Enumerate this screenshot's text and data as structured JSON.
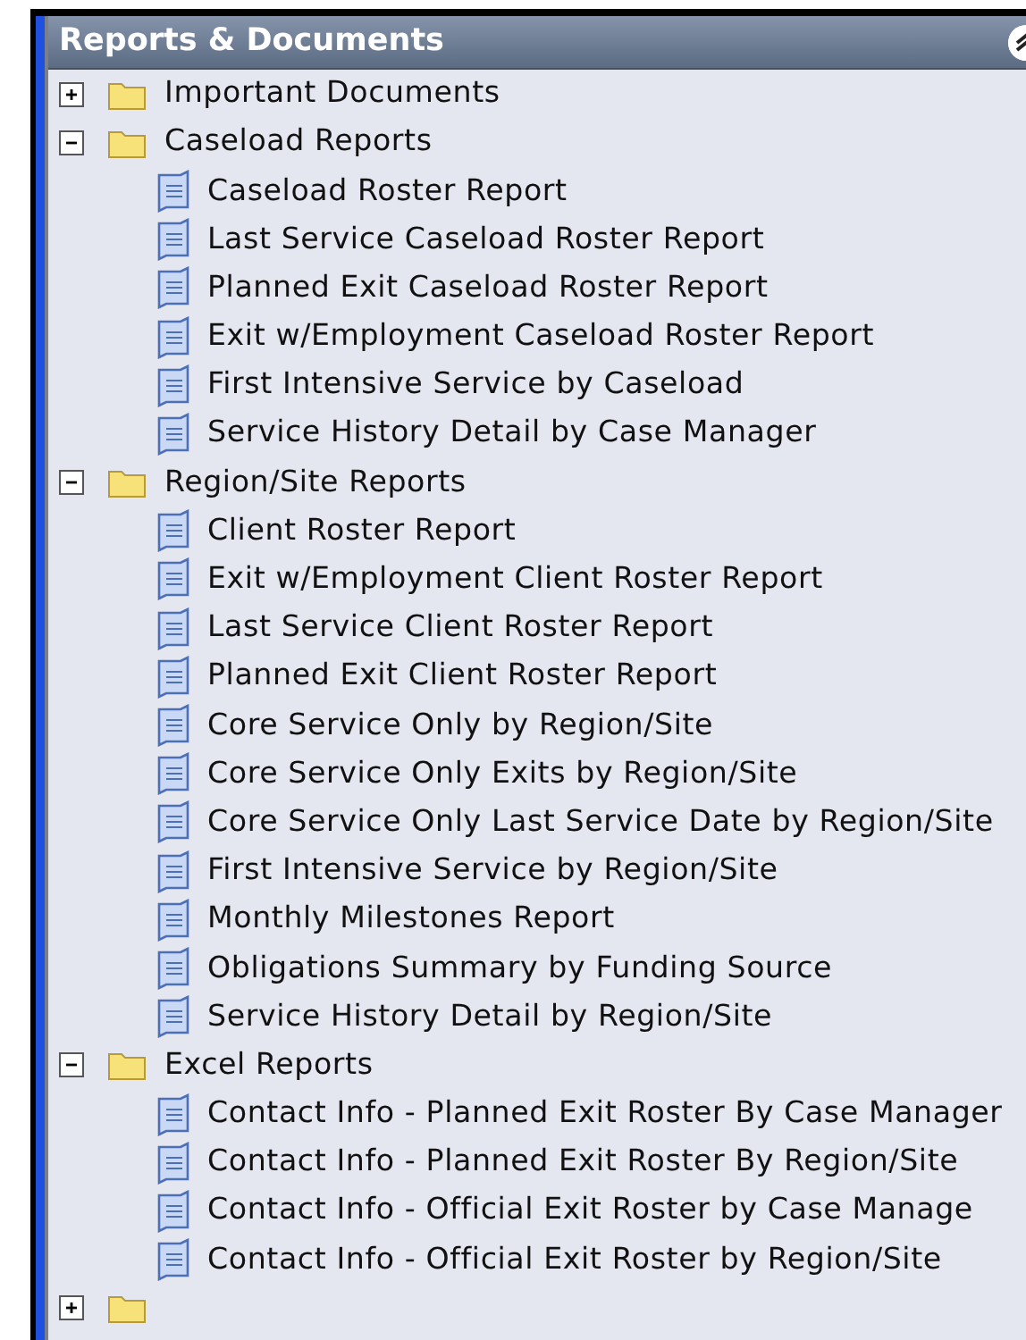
{
  "panel": {
    "title": "Reports & Documents"
  },
  "folders": [
    {
      "label": "Important Documents",
      "expanded": false
    },
    {
      "label": "Caseload Reports",
      "expanded": true,
      "children": [
        "Caseload Roster Report",
        "Last Service Caseload Roster Report",
        "Planned Exit Caseload Roster Report",
        "Exit w/Employment Caseload Roster Report",
        "First Intensive Service by Caseload",
        "Service History Detail by Case Manager"
      ]
    },
    {
      "label": "Region/Site Reports",
      "expanded": true,
      "children": [
        "Client Roster Report",
        "Exit w/Employment Client Roster Report",
        "Last Service Client Roster Report",
        "Planned Exit Client Roster Report",
        "Core Service Only by Region/Site",
        "Core Service Only Exits by Region/Site",
        "Core Service Only Last Service Date by Region/Site",
        "First Intensive Service by Region/Site",
        "Monthly Milestones Report",
        "Obligations Summary by Funding Source",
        "Service History Detail by Region/Site"
      ]
    },
    {
      "label": "Excel Reports",
      "expanded": true,
      "children": [
        "Contact Info - Planned Exit Roster By Case Manager",
        "Contact Info - Planned Exit Roster By Region/Site",
        "Contact Info - Official Exit Roster by Case Manage",
        "Contact Info - Official Exit Roster by Region/Site"
      ]
    },
    {
      "expanded": false
    }
  ]
}
